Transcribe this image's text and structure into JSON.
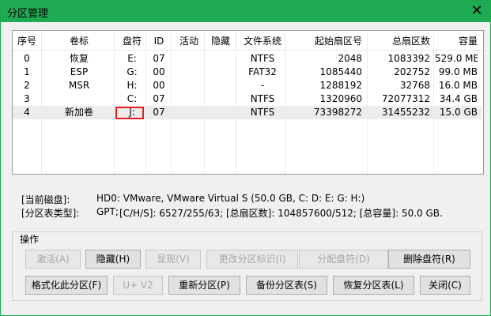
{
  "window": {
    "title": "分区管理",
    "close_glyph": "✕"
  },
  "table": {
    "columns": [
      "序号",
      "卷标",
      "盘符",
      "ID",
      "活动",
      "隐藏",
      "文件系统",
      "起始扇区号",
      "总扇区数",
      "容量"
    ],
    "rows": [
      [
        "0",
        "恢复",
        "E:",
        "07",
        "",
        "",
        "NTFS",
        "2048",
        "1083392",
        "529.0 MB"
      ],
      [
        "1",
        "ESP",
        "G:",
        "00",
        "",
        "",
        "FAT32",
        "1085440",
        "202752",
        "99.0 MB"
      ],
      [
        "2",
        "MSR",
        "H:",
        "00",
        "",
        "",
        "-",
        "1288192",
        "32768",
        "16.0 MB"
      ],
      [
        "3",
        "",
        "C:",
        "07",
        "",
        "",
        "NTFS",
        "1320960",
        "72077312",
        "34.4 GB"
      ],
      [
        "4",
        "新加卷",
        "J:",
        "07",
        "",
        "",
        "NTFS",
        "73398272",
        "31455232",
        "15.0 GB"
      ]
    ],
    "selected_row": 4
  },
  "info": {
    "disk_label": "[当前磁盘]:",
    "disk_value": "HD0: VMware, VMware Virtual S (50.0 GB, C: D: E: G: H:)",
    "type_label": "[分区表类型]:",
    "type_value": "GPT;",
    "chs": "[C/H/S]: 6527/255/63; [总扇区数]: 104857600/512; [总容量]: 50.0 GB."
  },
  "ops": {
    "group_label": "操作",
    "activate": "激活(A)",
    "hide": "隐藏(H)",
    "show": "显现(V)",
    "change_id": "更改分区标识(I)",
    "assign_letter": "分配盘符(D)",
    "delete_letter": "删除盘符(R)",
    "format": "格式化此分区(F)",
    "uv": "U+ V2",
    "repartition": "重新分区(P)",
    "backup": "备份分区表(S)",
    "restore": "恢复分区表(L)",
    "close": "关闭(C)"
  }
}
